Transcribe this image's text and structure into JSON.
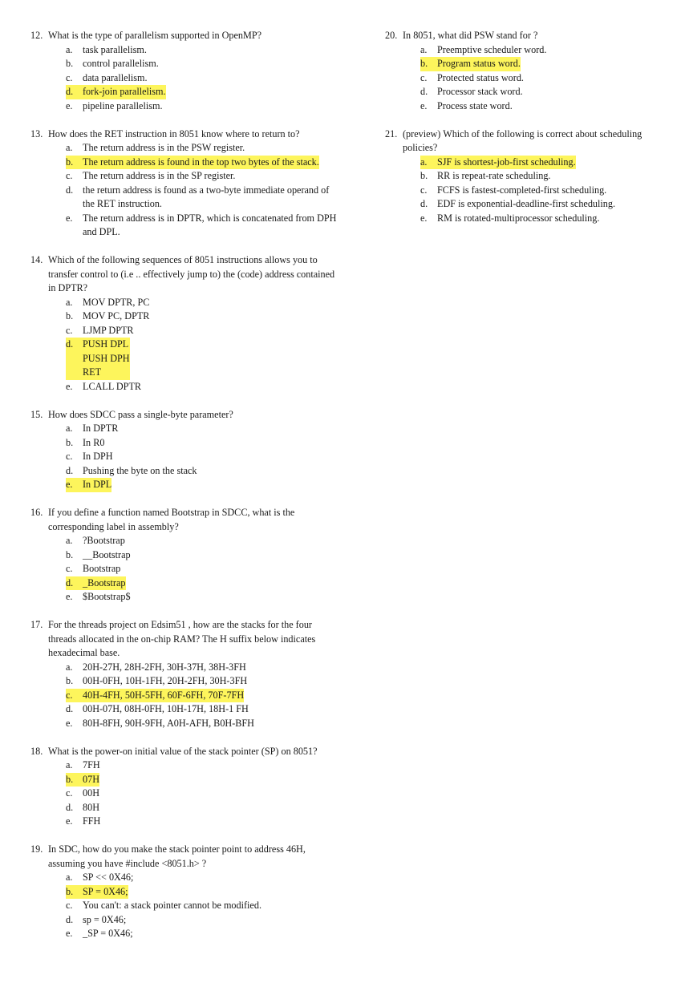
{
  "highlight_color": "#fdf55c",
  "left_column": [
    {
      "number": "12.",
      "text": "What is the type of parallelism supported in OpenMP?",
      "options": [
        {
          "label": "a.",
          "text": "task parallelism.",
          "highlighted": false
        },
        {
          "label": "b.",
          "text": "control parallelism.",
          "highlighted": false
        },
        {
          "label": "c.",
          "text": "data parallelism.",
          "highlighted": false
        },
        {
          "label": "d.",
          "text": "fork-join parallelism.",
          "highlighted": true
        },
        {
          "label": "e.",
          "text": "pipeline parallelism.",
          "highlighted": false
        }
      ]
    },
    {
      "number": "13.",
      "text": "How does the RET instruction in 8051 know where to return to?",
      "options": [
        {
          "label": "a.",
          "text": "The return address is in the PSW register.",
          "highlighted": false
        },
        {
          "label": "b.",
          "text": "The return address is found in the top two bytes of the stack.",
          "highlighted": true
        },
        {
          "label": "c.",
          "text": "The return address is in the SP register.",
          "highlighted": false
        },
        {
          "label": "d.",
          "text": "the return address is found as a two-byte immediate operand of the RET instruction.",
          "highlighted": false
        },
        {
          "label": "e.",
          "text": "The return address is in DPTR, which is concatenated from DPH and DPL.",
          "highlighted": false
        }
      ]
    },
    {
      "number": "14.",
      "text": "Which of the following sequences of 8051 instructions allows you to transfer control to (i.e .. effectively jump to) the (code) address contained in DPTR?",
      "options": [
        {
          "label": "a.",
          "text": "MOV DPTR, PC",
          "highlighted": false
        },
        {
          "label": "b.",
          "text": "MOV PC, DPTR",
          "highlighted": false
        },
        {
          "label": "c.",
          "text": "LJMP DPTR",
          "highlighted": false
        },
        {
          "label": "d.",
          "text": "PUSH DPL\nPUSH DPH\nRET",
          "highlighted": true
        },
        {
          "label": "e.",
          "text": "LCALL DPTR",
          "highlighted": false
        }
      ]
    },
    {
      "number": "15.",
      "text": "How does SDCC pass a single-byte parameter?",
      "options": [
        {
          "label": "a.",
          "text": "In DPTR",
          "highlighted": false
        },
        {
          "label": "b.",
          "text": "In R0",
          "highlighted": false
        },
        {
          "label": "c.",
          "text": "In DPH",
          "highlighted": false
        },
        {
          "label": "d.",
          "text": "Pushing the byte on the stack",
          "highlighted": false
        },
        {
          "label": "e.",
          "text": "In DPL",
          "highlighted": true
        }
      ]
    },
    {
      "number": "16.",
      "text": "If you define a function named Bootstrap in SDCC, what is the corresponding label in assembly?",
      "options": [
        {
          "label": "a.",
          "text": "?Bootstrap",
          "highlighted": false
        },
        {
          "label": "b.",
          "text": "__Bootstrap",
          "highlighted": false
        },
        {
          "label": "c.",
          "text": "Bootstrap",
          "highlighted": false
        },
        {
          "label": "d.",
          "text": "_Bootstrap",
          "highlighted": true
        },
        {
          "label": "e.",
          "text": "$Bootstrap$",
          "highlighted": false
        }
      ]
    },
    {
      "number": "17.",
      "text": "For the threads project on Edsim51 , how are the stacks for the four threads allocated in the on-chip RAM? The H suffix below indicates hexadecimal base.",
      "options": [
        {
          "label": "a.",
          "text": "20H-27H, 28H-2FH, 30H-37H, 38H-3FH",
          "highlighted": false
        },
        {
          "label": "b.",
          "text": "00H-0FH, 10H-1FH, 20H-2FH, 30H-3FH",
          "highlighted": false
        },
        {
          "label": "c.",
          "text": "40H-4FH, 50H-5FH, 60F-6FH, 70F-7FH",
          "highlighted": true
        },
        {
          "label": "d.",
          "text": "00H-07H, 08H-0FH, 10H-17H, 18H-1 FH",
          "highlighted": false
        },
        {
          "label": "e.",
          "text": "80H-8FH, 90H-9FH, A0H-AFH, B0H-BFH",
          "highlighted": false
        }
      ]
    },
    {
      "number": "18.",
      "text": "What is the power-on initial value of the stack pointer (SP) on 8051?",
      "options": [
        {
          "label": "a.",
          "text": "7FH",
          "highlighted": false
        },
        {
          "label": "b.",
          "text": "07H",
          "highlighted": true
        },
        {
          "label": "c.",
          "text": "00H",
          "highlighted": false
        },
        {
          "label": "d.",
          "text": "80H",
          "highlighted": false
        },
        {
          "label": "e.",
          "text": "FFH",
          "highlighted": false
        }
      ]
    },
    {
      "number": "19.",
      "text": "In SDC, how do you make the stack pointer point to address 46H, assuming you have  #include <8051.h> ?",
      "options": [
        {
          "label": "a.",
          "text": "SP << 0X46;",
          "highlighted": false
        },
        {
          "label": "b.",
          "text": "SP = 0X46;",
          "highlighted": true
        },
        {
          "label": "c.",
          "text": "You can't: a stack pointer cannot be modified.",
          "highlighted": false
        },
        {
          "label": "d.",
          "text": "sp = 0X46;",
          "highlighted": false
        },
        {
          "label": "e.",
          "text": "_SP = 0X46;",
          "highlighted": false
        }
      ]
    }
  ],
  "right_column": [
    {
      "number": "20.",
      "text": "In 8051, what did PSW stand for ?",
      "options": [
        {
          "label": "a.",
          "text": "Preemptive scheduler word.",
          "highlighted": false
        },
        {
          "label": "b.",
          "text": "Program status word.",
          "highlighted": true
        },
        {
          "label": "c.",
          "text": "Protected status word.",
          "highlighted": false
        },
        {
          "label": "d.",
          "text": "Processor stack word.",
          "highlighted": false
        },
        {
          "label": "e.",
          "text": "Process state word.",
          "highlighted": false
        }
      ]
    },
    {
      "number": "21.",
      "text": "(preview) Which of the following is correct about scheduling policies?",
      "options": [
        {
          "label": "a.",
          "text": "SJF is shortest-job-first scheduling.",
          "highlighted": true
        },
        {
          "label": "b.",
          "text": "RR is repeat-rate scheduling.",
          "highlighted": false
        },
        {
          "label": "c.",
          "text": "FCFS is fastest-completed-first scheduling.",
          "highlighted": false
        },
        {
          "label": "d.",
          "text": "EDF is exponential-deadline-first scheduling.",
          "highlighted": false
        },
        {
          "label": "e.",
          "text": "RM is rotated-multiprocessor scheduling.",
          "highlighted": false
        }
      ]
    }
  ]
}
